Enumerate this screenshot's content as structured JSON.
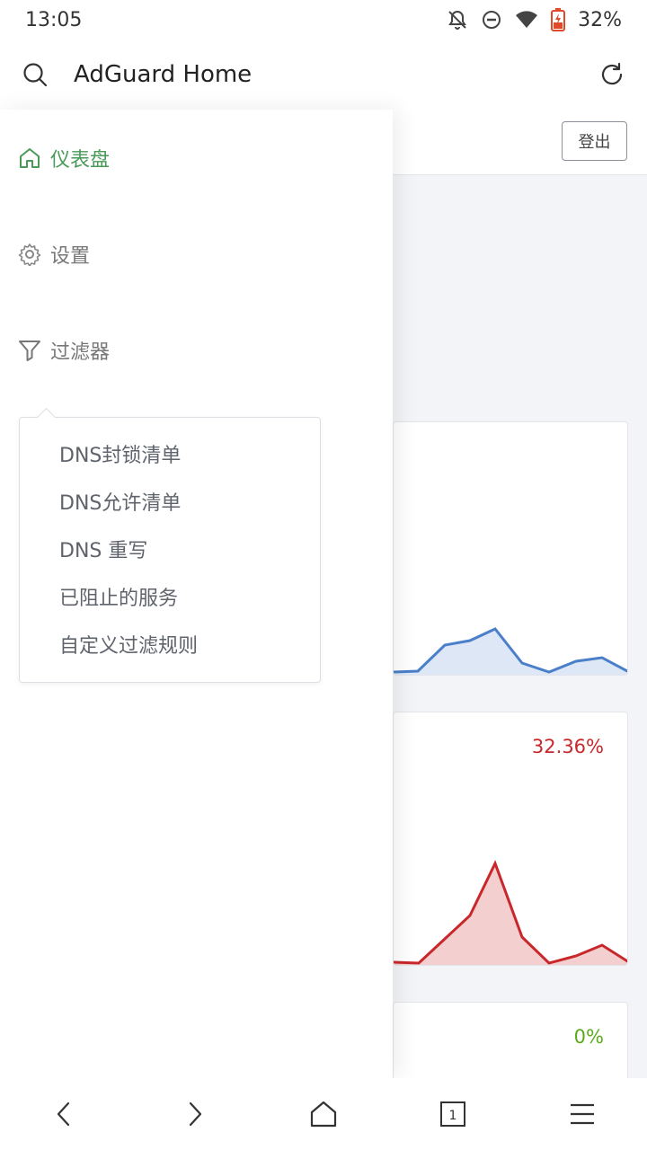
{
  "status_bar": {
    "time": "13:05",
    "battery": "32%"
  },
  "app_bar": {
    "title": "AdGuard Home"
  },
  "content": {
    "logout_label": "登出",
    "card2_percent": "32.36%",
    "card3_percent": "0%",
    "colors": {
      "blue_series": "#4a7fc9",
      "red_series": "#c8282b",
      "green_text": "#5bab1b"
    }
  },
  "drawer": {
    "items": [
      {
        "label": "仪表盘",
        "icon": "home-icon",
        "active": true
      },
      {
        "label": "设置",
        "icon": "gear-icon",
        "active": false
      },
      {
        "label": "过滤器",
        "icon": "filter-icon",
        "active": false
      }
    ],
    "filters_menu": [
      "DNS封锁清单",
      "DNS允许清单",
      "DNS 重写",
      "已阻止的服务",
      "自定义过滤规则"
    ],
    "active_color": "#4a9a5a"
  },
  "bottom_bar": {
    "icons": [
      "back-icon",
      "forward-icon",
      "home-icon",
      "tabs-icon",
      "menu-icon"
    ],
    "tab_count": "1"
  }
}
